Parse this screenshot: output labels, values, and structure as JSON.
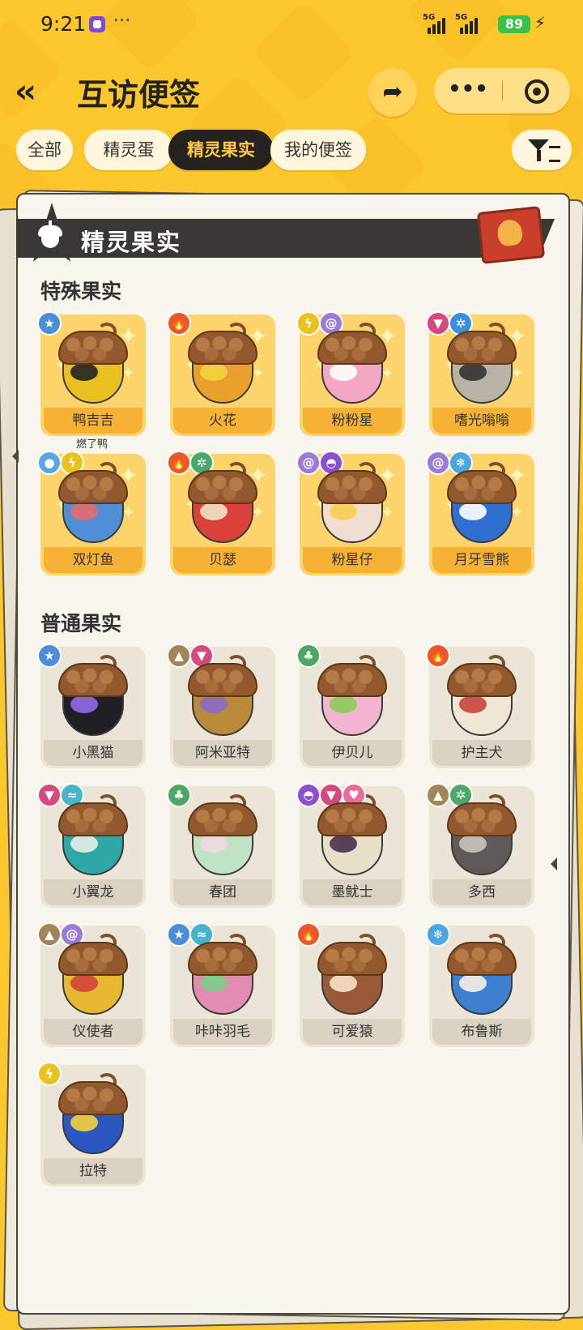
{
  "status_bar": {
    "time": "9:21",
    "more": "···",
    "network1": "5G",
    "network2": "5G",
    "battery": "89"
  },
  "header": {
    "back_icon": "double-chevron-left-icon",
    "title": "互访便签",
    "more_label": "•••"
  },
  "tabs": [
    {
      "label": "全部",
      "active": false
    },
    {
      "label": "精灵蛋",
      "active": false
    },
    {
      "label": "精灵果实",
      "active": true
    },
    {
      "label": "我的便签",
      "active": false
    }
  ],
  "card": {
    "title": "精灵果实"
  },
  "special": {
    "title": "特殊果实",
    "note": "燃了鸭",
    "items": [
      {
        "name": "鸭吉吉",
        "badges": [
          {
            "icon": "star-icon",
            "color": "#4a8fd6"
          }
        ],
        "body": "#e8c020",
        "accent": "#222222"
      },
      {
        "name": "火花",
        "badges": [
          {
            "icon": "fire-icon",
            "color": "#e8582b"
          }
        ],
        "body": "#e9a12c",
        "accent": "#f4d23c"
      },
      {
        "name": "粉粉星",
        "badges": [
          {
            "icon": "lightning-icon",
            "color": "#e9c21c"
          },
          {
            "icon": "swirl-icon",
            "color": "#9a7bd8"
          }
        ],
        "body": "#f2a7c4",
        "accent": "#ffffff"
      },
      {
        "name": "嗜光嗡嗡",
        "badges": [
          {
            "icon": "demon-icon",
            "color": "#d54a7e"
          },
          {
            "icon": "gear-icon",
            "color": "#3b8fe0"
          }
        ],
        "body": "#b9b3a6",
        "accent": "#333333"
      },
      {
        "name": "双灯鱼",
        "badges": [
          {
            "icon": "water-icon",
            "color": "#5aa6e0"
          },
          {
            "icon": "lightning-icon",
            "color": "#e9c21c"
          }
        ],
        "body": "#4f8fd6",
        "accent": "#e46a6a"
      },
      {
        "name": "贝瑟",
        "badges": [
          {
            "icon": "fire-icon",
            "color": "#e8582b"
          },
          {
            "icon": "gear-icon",
            "color": "#49a86a"
          }
        ],
        "body": "#d8423a",
        "accent": "#f1e4c4"
      },
      {
        "name": "粉星仔",
        "badges": [
          {
            "icon": "swirl-icon",
            "color": "#9a7bd8"
          },
          {
            "icon": "ghost-icon",
            "color": "#8c4fd0"
          }
        ],
        "body": "#f1ddd2",
        "accent": "#f6cf52"
      },
      {
        "name": "月牙雪熊",
        "badges": [
          {
            "icon": "swirl-icon",
            "color": "#9a7bd8"
          },
          {
            "icon": "snowflake-icon",
            "color": "#4aa6e0"
          }
        ],
        "body": "#2f6fd0",
        "accent": "#ffffff"
      }
    ]
  },
  "normal": {
    "title": "普通果实",
    "items": [
      {
        "name": "小黑猫",
        "badges": [
          {
            "icon": "star-icon",
            "color": "#4a8fd6"
          }
        ],
        "body": "#1f1f24",
        "accent": "#8f6ae8"
      },
      {
        "name": "阿米亚特",
        "badges": [
          {
            "icon": "mountain-icon",
            "color": "#a2845b"
          },
          {
            "icon": "demon-icon",
            "color": "#d54a7e"
          }
        ],
        "body": "#b98a3a",
        "accent": "#8b6ac8"
      },
      {
        "name": "伊贝儿",
        "badges": [
          {
            "icon": "leaf-icon",
            "color": "#4aa862"
          }
        ],
        "body": "#f2b5cf",
        "accent": "#8fcb5a"
      },
      {
        "name": "护主犬",
        "badges": [
          {
            "icon": "fire-icon",
            "color": "#e8582b"
          }
        ],
        "body": "#f0e6d6",
        "accent": "#c8453a"
      },
      {
        "name": "小翼龙",
        "badges": [
          {
            "icon": "demon-icon",
            "color": "#d54a7e"
          },
          {
            "icon": "wing-icon",
            "color": "#45b6c9"
          }
        ],
        "body": "#2fa7a6",
        "accent": "#e8f0e6"
      },
      {
        "name": "春团",
        "badges": [
          {
            "icon": "leaf-icon",
            "color": "#4aa862"
          }
        ],
        "body": "#bfe3c4",
        "accent": "#f2d8e0"
      },
      {
        "name": "墨鱿士",
        "badges": [
          {
            "icon": "ghost-icon",
            "color": "#8c4fd0"
          },
          {
            "icon": "demon-icon",
            "color": "#d54a7e"
          },
          {
            "icon": "heart-icon",
            "color": "#ec6b98"
          }
        ],
        "body": "#e6e0c8",
        "accent": "#4a2f4f"
      },
      {
        "name": "多西",
        "badges": [
          {
            "icon": "mountain-icon",
            "color": "#a2845b"
          },
          {
            "icon": "gear-icon",
            "color": "#49a86a"
          }
        ],
        "body": "#5f5a58",
        "accent": "#c9c3bd"
      },
      {
        "name": "仪使者",
        "badges": [
          {
            "icon": "mountain-icon",
            "color": "#a2845b"
          },
          {
            "icon": "swirl-icon",
            "color": "#9a7bd8"
          }
        ],
        "body": "#e8b832",
        "accent": "#d0443a"
      },
      {
        "name": "咔咔羽毛",
        "badges": [
          {
            "icon": "star-icon",
            "color": "#4a8fd6"
          },
          {
            "icon": "wing-icon",
            "color": "#45b6c9"
          }
        ],
        "body": "#e38cb2",
        "accent": "#7ccc8a"
      },
      {
        "name": "可爱猿",
        "badges": [
          {
            "icon": "fire-icon",
            "color": "#e8582b"
          }
        ],
        "body": "#9a5a3a",
        "accent": "#f5e2c8"
      },
      {
        "name": "布鲁斯",
        "badges": [
          {
            "icon": "snowflake-icon",
            "color": "#4aa6e0"
          }
        ],
        "body": "#3f7fd0",
        "accent": "#f6f2e8"
      },
      {
        "name": "拉特",
        "badges": [
          {
            "icon": "lightning-icon",
            "color": "#e9c21c"
          }
        ],
        "body": "#2a56c0",
        "accent": "#f5d23a"
      }
    ]
  }
}
